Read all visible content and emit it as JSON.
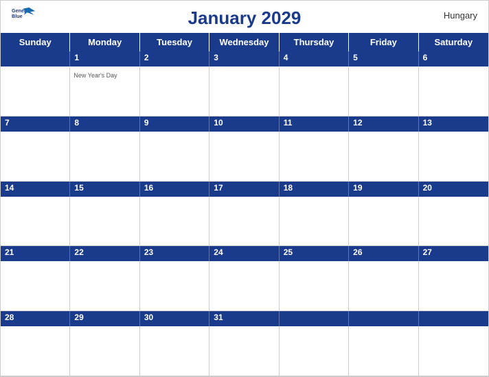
{
  "header": {
    "title": "January 2029",
    "country": "Hungary",
    "logo_line1": "General",
    "logo_line2": "Blue"
  },
  "days_of_week": [
    "Sunday",
    "Monday",
    "Tuesday",
    "Wednesday",
    "Thursday",
    "Friday",
    "Saturday"
  ],
  "weeks": [
    {
      "days": [
        {
          "num": "",
          "holiday": ""
        },
        {
          "num": "1",
          "holiday": "New Year's Day"
        },
        {
          "num": "2",
          "holiday": ""
        },
        {
          "num": "3",
          "holiday": ""
        },
        {
          "num": "4",
          "holiday": ""
        },
        {
          "num": "5",
          "holiday": ""
        },
        {
          "num": "6",
          "holiday": ""
        }
      ]
    },
    {
      "days": [
        {
          "num": "7",
          "holiday": ""
        },
        {
          "num": "8",
          "holiday": ""
        },
        {
          "num": "9",
          "holiday": ""
        },
        {
          "num": "10",
          "holiday": ""
        },
        {
          "num": "11",
          "holiday": ""
        },
        {
          "num": "12",
          "holiday": ""
        },
        {
          "num": "13",
          "holiday": ""
        }
      ]
    },
    {
      "days": [
        {
          "num": "14",
          "holiday": ""
        },
        {
          "num": "15",
          "holiday": ""
        },
        {
          "num": "16",
          "holiday": ""
        },
        {
          "num": "17",
          "holiday": ""
        },
        {
          "num": "18",
          "holiday": ""
        },
        {
          "num": "19",
          "holiday": ""
        },
        {
          "num": "20",
          "holiday": ""
        }
      ]
    },
    {
      "days": [
        {
          "num": "21",
          "holiday": ""
        },
        {
          "num": "22",
          "holiday": ""
        },
        {
          "num": "23",
          "holiday": ""
        },
        {
          "num": "24",
          "holiday": ""
        },
        {
          "num": "25",
          "holiday": ""
        },
        {
          "num": "26",
          "holiday": ""
        },
        {
          "num": "27",
          "holiday": ""
        }
      ]
    },
    {
      "days": [
        {
          "num": "28",
          "holiday": ""
        },
        {
          "num": "29",
          "holiday": ""
        },
        {
          "num": "30",
          "holiday": ""
        },
        {
          "num": "31",
          "holiday": ""
        },
        {
          "num": "",
          "holiday": ""
        },
        {
          "num": "",
          "holiday": ""
        },
        {
          "num": "",
          "holiday": ""
        }
      ]
    }
  ],
  "colors": {
    "header_blue": "#1a3a8c",
    "border": "#cccccc",
    "text_blue": "#1a3a8c"
  }
}
